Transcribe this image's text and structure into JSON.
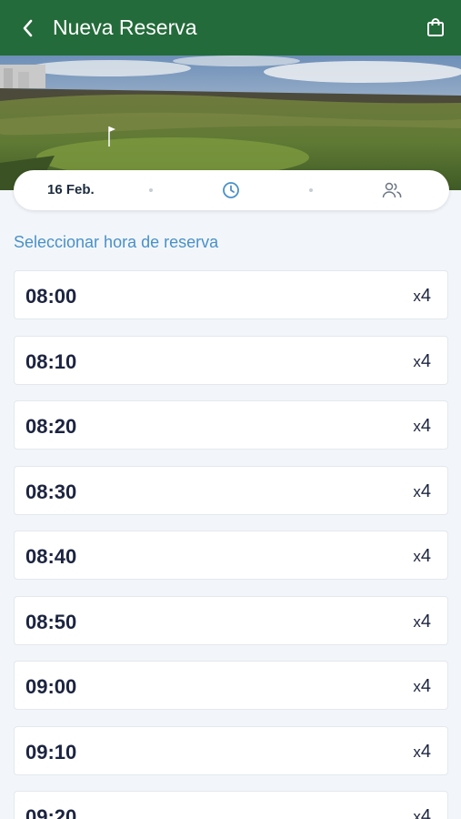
{
  "header": {
    "title": "Nueva Reserva"
  },
  "steps": {
    "date": "16 Feb."
  },
  "section_title": "Seleccionar hora de reserva",
  "slots": [
    {
      "time": "08:00",
      "cap_prefix": "x",
      "cap": "4"
    },
    {
      "time": "08:10",
      "cap_prefix": "x",
      "cap": "4"
    },
    {
      "time": "08:20",
      "cap_prefix": "x",
      "cap": "4"
    },
    {
      "time": "08:30",
      "cap_prefix": "x",
      "cap": "4"
    },
    {
      "time": "08:40",
      "cap_prefix": "x",
      "cap": "4"
    },
    {
      "time": "08:50",
      "cap_prefix": "x",
      "cap": "4"
    },
    {
      "time": "09:00",
      "cap_prefix": "x",
      "cap": "4"
    },
    {
      "time": "09:10",
      "cap_prefix": "x",
      "cap": "4"
    },
    {
      "time": "09:20",
      "cap_prefix": "x",
      "cap": "4"
    }
  ],
  "colors": {
    "header_bg": "#236b3a",
    "accent_blue": "#4a90c8",
    "time_text": "#1c2440",
    "page_bg": "#f2f6fa"
  },
  "icons": {
    "back": "chevron-left-icon",
    "cart": "shopping-bag-icon",
    "clock": "clock-icon",
    "users": "users-icon"
  }
}
